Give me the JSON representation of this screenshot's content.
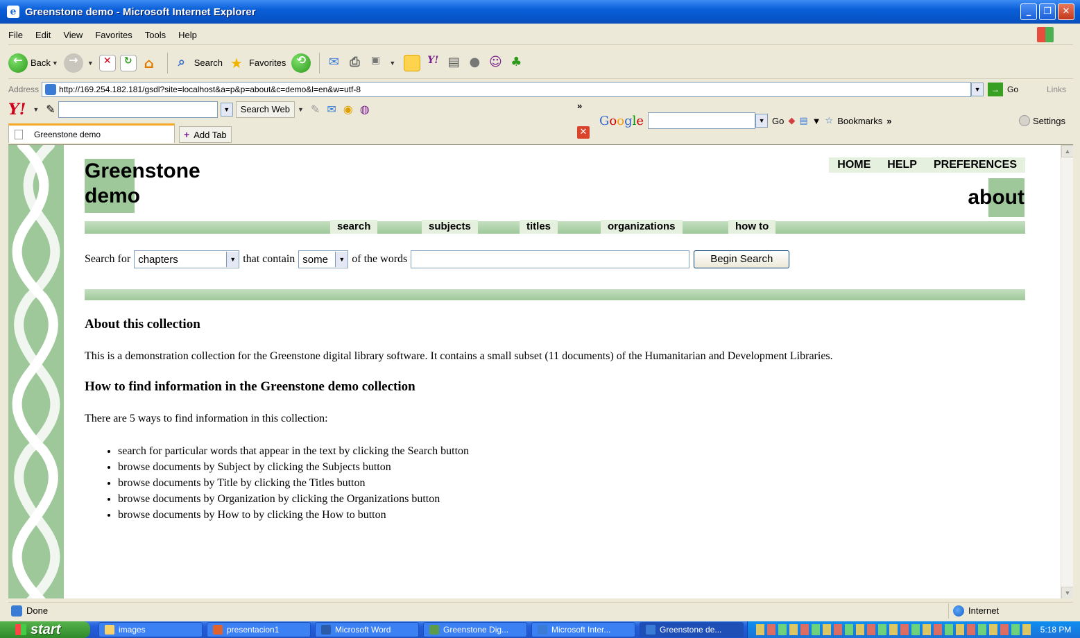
{
  "window": {
    "title": "Greenstone demo - Microsoft Internet Explorer"
  },
  "menu": [
    "File",
    "Edit",
    "View",
    "Favorites",
    "Tools",
    "Help"
  ],
  "toolbar": {
    "back": "Back",
    "search": "Search",
    "favorites": "Favorites"
  },
  "address": {
    "label": "Address",
    "url": "http://169.254.182.181/gsdl?site=localhost&a=p&p=about&c=demo&l=en&w=utf-8",
    "go": "Go",
    "links": "Links"
  },
  "yahoo": {
    "search_web": "Search Web"
  },
  "google": {
    "go": "Go",
    "bookmarks": "Bookmarks",
    "settings": "Settings"
  },
  "tabs": {
    "active": "Greenstone demo",
    "add": "Add Tab"
  },
  "page": {
    "logo_line1": "Greenstone",
    "logo_line2": "demo",
    "top_nav": [
      "HOME",
      "HELP",
      "PREFERENCES"
    ],
    "section": "about",
    "nav": [
      "search",
      "subjects",
      "titles",
      "organizations",
      "how to"
    ],
    "search": {
      "label_for": "Search for",
      "index": "chapters",
      "label_contain": "that contain",
      "mode": "some",
      "label_words": "of the words",
      "query": "",
      "button": "Begin Search"
    },
    "about_heading": "About this collection",
    "about_text": "This is a demonstration collection for the Greenstone digital library software. It contains a small subset (11 documents) of the Humanitarian and Development Libraries.",
    "howto_heading": "How to find information in the Greenstone demo collection",
    "howto_intro": "There are 5 ways to find information in this collection:",
    "howto_items": [
      "search for particular words that appear in the text by clicking the Search button",
      "browse documents by Subject by clicking the Subjects button",
      "browse documents by Title by clicking the Titles button",
      "browse documents by Organization by clicking the Organizations button",
      "browse documents by How to by clicking the How to button"
    ]
  },
  "status": {
    "text": "Done",
    "zone": "Internet"
  },
  "taskbar": {
    "start": "start",
    "tasks": [
      "images",
      "presentacion1",
      "Microsoft Word",
      "Greenstone Dig...",
      "Microsoft Inter...",
      "Greenstone de..."
    ],
    "clock": "5:18 PM"
  },
  "colors": {
    "greenstone_green": "#9ec89a",
    "nav_tab_bg": "#e5f0df"
  }
}
